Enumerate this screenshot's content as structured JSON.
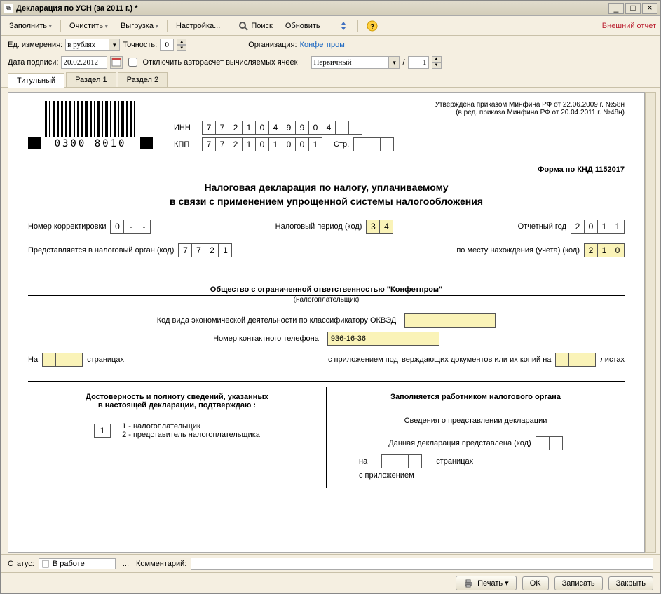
{
  "window": {
    "title": "Декларация по УСН (за 2011 г.) *"
  },
  "toolbar": {
    "fill": "Заполнить",
    "clear": "Очистить",
    "upload": "Выгрузка",
    "settings": "Настройка...",
    "find": "Поиск",
    "refresh": "Обновить",
    "external": "Внешний отчет"
  },
  "params": {
    "unit_label": "Ед. измерения:",
    "unit_value": "в рублях",
    "precision_label": "Точность:",
    "precision_value": "0",
    "org_label": "Организация:",
    "org_value": "Конфетпром",
    "signdate_label": "Дата подписи:",
    "signdate_value": "20.02.2012",
    "disable_autocalc": "Отключить авторасчет вычисляемых ячеек",
    "doctype_value": "Первичный",
    "slash": "/",
    "corrnum": "1"
  },
  "tabs": {
    "t1": "Титульный",
    "t2": "Раздел 1",
    "t3": "Раздел 2"
  },
  "doc": {
    "approval1": "Утверждена приказом Минфина РФ от 22.06.2009 г. №58н",
    "approval2": "(в ред. приказа Минфина РФ от 20.04.2011 г. №48н)",
    "inn_label": "ИНН",
    "inn": [
      "7",
      "7",
      "2",
      "1",
      "0",
      "4",
      "9",
      "9",
      "0",
      "4",
      "",
      ""
    ],
    "kpp_label": "КПП",
    "kpp": [
      "7",
      "7",
      "2",
      "1",
      "0",
      "1",
      "0",
      "0",
      "1"
    ],
    "page_label": "Стр.",
    "page": [
      "",
      "",
      ""
    ],
    "formcode": "Форма по КНД 1152017",
    "title1": "Налоговая декларация по налогу, уплачиваемому",
    "title2": "в связи с применением упрощенной системы налогообложения",
    "corr_label": "Номер корректировки",
    "corr": [
      "0",
      "-",
      "-"
    ],
    "period_label": "Налоговый период (код)",
    "period": [
      "3",
      "4"
    ],
    "year_label": "Отчетный год",
    "year": [
      "2",
      "0",
      "1",
      "1"
    ],
    "taxorg_label": "Представляется в налоговый орган (код)",
    "taxorg": [
      "7",
      "7",
      "2",
      "1"
    ],
    "place_label": "по месту нахождения (учета) (код)",
    "place": [
      "2",
      "1",
      "0"
    ],
    "company": "Общество с ограниченной ответственностью \"Конфетпром\"",
    "taxpayer_note": "(налогоплательщик)",
    "okved_label": "Код вида экономической деятельности по классификатору ОКВЭД",
    "phone_label": "Номер контактного телефона",
    "phone": "936-16-36",
    "pages_on_label": "На",
    "pages_label": "страницах",
    "attach_label": "с приложением подтверждающих документов или их копий на",
    "sheets_label": "листах",
    "confirm_title1": "Достоверность и полноту сведений, указанных",
    "confirm_title2": "в настоящей декларации, подтверждаю :",
    "confirm_opt1": "1 - налогоплательщик",
    "confirm_opt2": "2 - представитель налогоплательщика",
    "confirm_val": "1",
    "taxworker_title": "Заполняется работником налогового органа",
    "submission_info": "Сведения о представлении декларации",
    "templ1": "Данная декларация представлена (код)",
    "templ2a": "на",
    "templ2b": "страницах",
    "templ3": "с приложением",
    "barcode_text": "0300 8010"
  },
  "status": {
    "status_label": "Статус:",
    "status_value": "В работе",
    "comment_label": "Комментарий:"
  },
  "footer": {
    "print": "Печать",
    "ok": "OK",
    "save": "Записать",
    "close": "Закрыть"
  }
}
